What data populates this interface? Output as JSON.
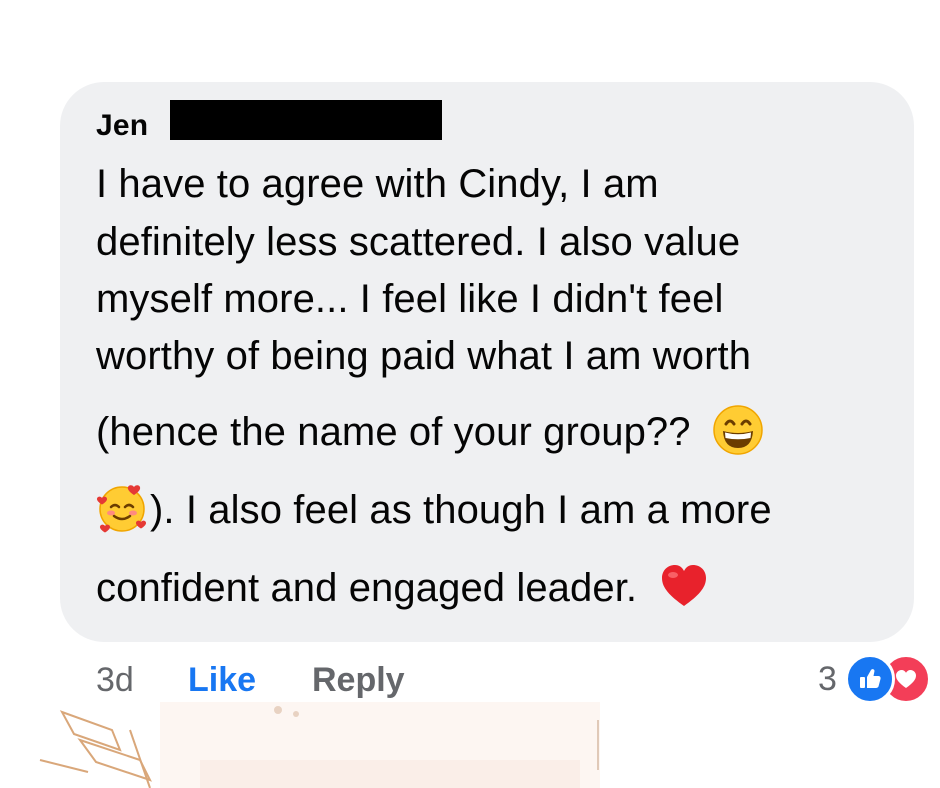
{
  "comment": {
    "author": "Jen",
    "lines": [
      "I have to agree with Cindy, I am",
      "definitely less scattered. I also value",
      "myself more... I feel like I didn't feel",
      "worthy of being paid what I am worth",
      "(hence the name of your group??",
      "). I also feel as though I am a more",
      "confident and engaged leader."
    ],
    "emojis": [
      "grinning-face-emoji",
      "smiling-face-with-hearts-emoji",
      "red-heart-emoji"
    ]
  },
  "actions": {
    "time": "3d",
    "like_label": "Like",
    "reply_label": "Reply"
  },
  "reactions": {
    "count": "3",
    "types": [
      "like-icon",
      "love-icon"
    ]
  },
  "colors": {
    "bubble": "#eff0f2",
    "link_blue": "#1877f2",
    "muted": "#65676b",
    "love": "#f33e58"
  }
}
